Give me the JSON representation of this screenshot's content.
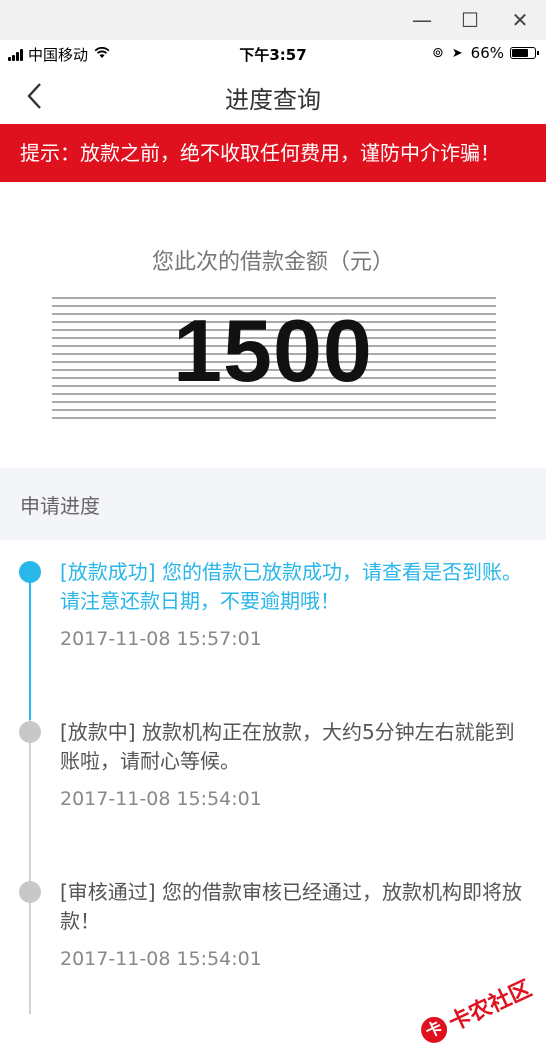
{
  "window": {
    "minimize_icon": "minimize-icon",
    "maximize_icon": "maximize-icon",
    "close_icon": "close-icon"
  },
  "status_bar": {
    "carrier": "中国移动",
    "time": "下午3:57",
    "battery": "66%"
  },
  "nav": {
    "title": "进度查询",
    "back_icon": "chevron-left-icon"
  },
  "notice": {
    "text": "提示：放款之前，绝不收取任何费用，谨防中介诈骗！"
  },
  "loan": {
    "label": "您此次的借款金额（元）",
    "amount": "1500"
  },
  "progress": {
    "header": "申请进度",
    "items": [
      {
        "text": "[放款成功] 您的借款已放款成功，请查看是否到账。请注意还款日期，不要逾期哦！",
        "time": "2017-11-08 15:57:01",
        "active": true
      },
      {
        "text": "[放款中] 放款机构正在放款，大约5分钟左右就能到账啦，请耐心等候。",
        "time": "2017-11-08 15:54:01",
        "active": false
      },
      {
        "text": "[审核通过] 您的借款审核已经通过，放款机构即将放款！",
        "time": "2017-11-08 15:54:01",
        "active": false
      }
    ]
  },
  "colors": {
    "accent": "#29b6e8",
    "alert": "#e0111e",
    "inactive": "#c8c8c8"
  },
  "watermark": {
    "text": "卡农社区"
  }
}
